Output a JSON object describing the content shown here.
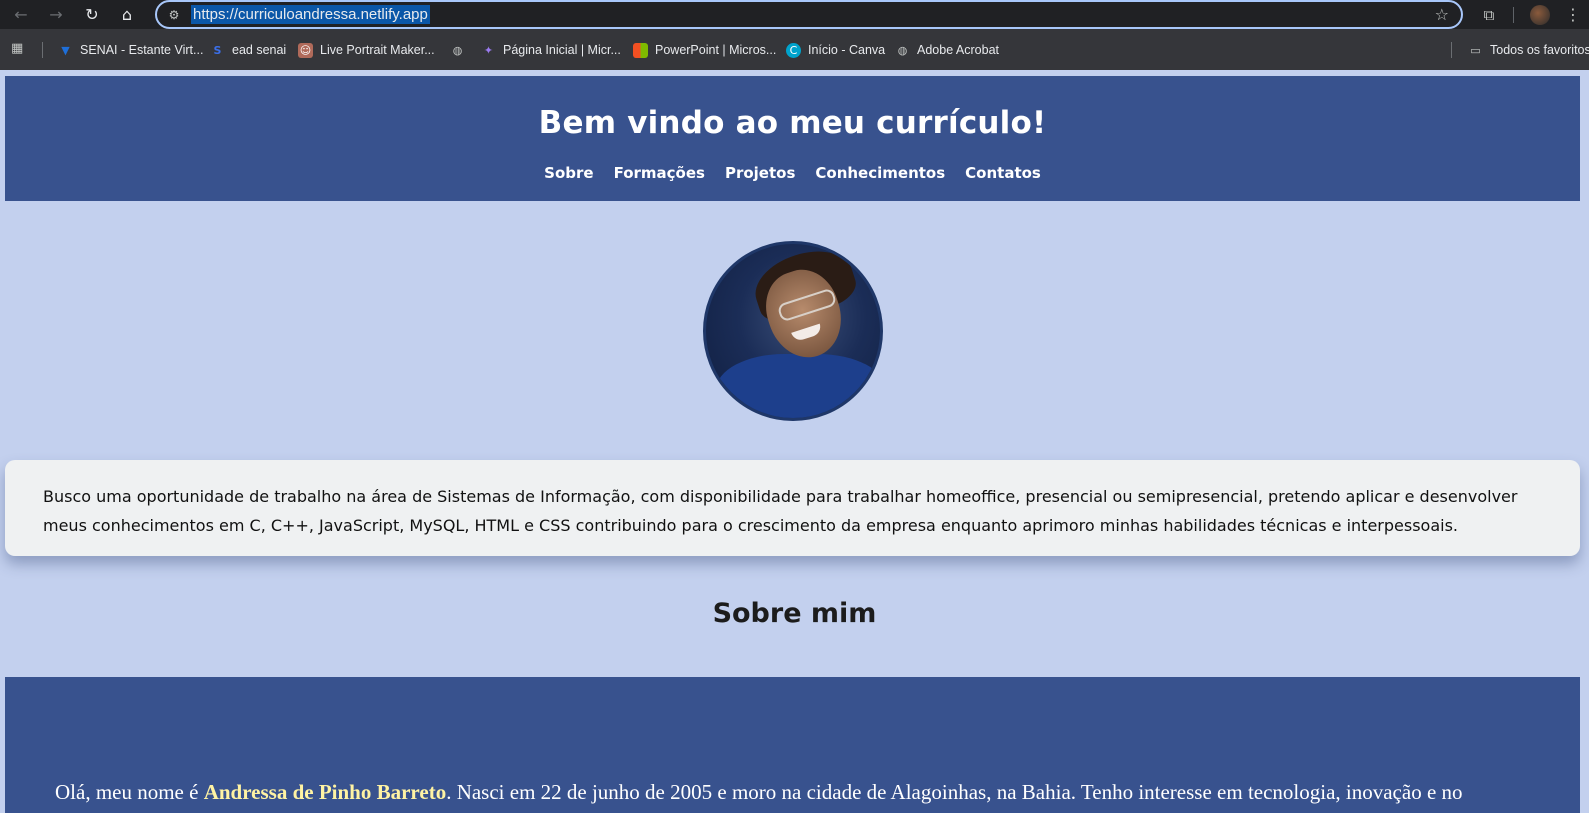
{
  "browser": {
    "url": "https://curriculoandressa.netlify.app",
    "nav_icons": {
      "back": "back-arrow-icon",
      "forward": "forward-arrow-icon",
      "reload": "reload-icon",
      "home": "home-icon"
    },
    "bookmarks": [
      {
        "label": "SENAI - Estante Virt...",
        "icon": "senai-icon",
        "color": "#1e6fd9",
        "glyph": "▼"
      },
      {
        "label": "ead senai",
        "icon": "ead-senai-icon",
        "color": "#1f4fd6",
        "glyph": "S"
      },
      {
        "label": "Live Portrait Maker...",
        "icon": "portrait-icon",
        "color": "#b06a5a",
        "glyph": "☺"
      },
      {
        "label": "",
        "icon": "globe-icon",
        "color": "#5f6368",
        "glyph": "◍"
      },
      {
        "label": "Página Inicial | Micr...",
        "icon": "copilot-icon",
        "color": "#7b61d6",
        "glyph": "✦"
      },
      {
        "label": "PowerPoint | Micros...",
        "icon": "microsoft-icon",
        "color": "#f25022",
        "glyph": "▦"
      },
      {
        "label": "Início - Canva",
        "icon": "canva-icon",
        "color": "#00c4cc",
        "glyph": "C"
      },
      {
        "label": "Adobe Acrobat",
        "icon": "globe-icon",
        "color": "#5f6368",
        "glyph": "◍"
      }
    ],
    "all_bookmarks": "Todos os favoritos"
  },
  "header": {
    "title": "Bem vindo ao meu currículo!",
    "nav": [
      "Sobre",
      "Formações",
      "Projetos",
      "Conhecimentos",
      "Contatos"
    ]
  },
  "objective": {
    "text": "Busco uma oportunidade de trabalho na área de Sistemas de Informação, com disponibilidade para trabalhar homeoffice, presencial ou semipresencial, pretendo aplicar e desenvolver meus conhecimentos em C, C++, JavaScript, MySQL, HTML e CSS contribuindo para o crescimento da empresa enquanto aprimoro minhas habilidades técnicas e interpessoais."
  },
  "about": {
    "section_title": "Sobre mim",
    "intro": "Olá, meu nome é ",
    "name": "Andressa de Pinho Barreto",
    "rest": ". Nasci em 22 de junho de 2005 e moro na cidade de Alagoinhas, na Bahia. Tenho interesse em tecnologia, inovação e no"
  },
  "colors": {
    "header_bg": "#38528e",
    "page_bg": "#c3d0ee",
    "card_bg": "#eff1f2",
    "highlight": "#fff3a3"
  }
}
